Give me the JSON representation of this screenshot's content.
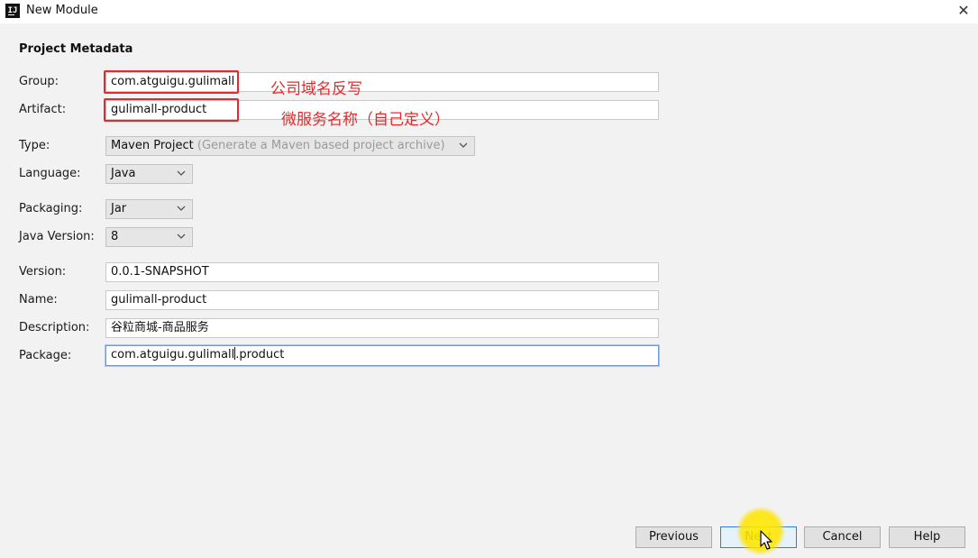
{
  "window": {
    "title": "New Module",
    "app_icon_text": "IJ",
    "close_glyph": "✕"
  },
  "section_title": "Project Metadata",
  "fields": {
    "group": {
      "label": "Group:",
      "value": "com.atguigu.gulimall"
    },
    "artifact": {
      "label": "Artifact:",
      "value": "gulimall-product"
    },
    "type": {
      "label": "Type:",
      "value": "Maven Project",
      "hint": "(Generate a Maven based project archive)"
    },
    "language": {
      "label": "Language:",
      "value": "Java"
    },
    "packaging": {
      "label": "Packaging:",
      "value": "Jar"
    },
    "java_version": {
      "label": "Java Version:",
      "value": "8"
    },
    "version": {
      "label": "Version:",
      "value": "0.0.1-SNAPSHOT"
    },
    "name": {
      "label": "Name:",
      "value": "gulimall-product"
    },
    "description": {
      "label": "Description:",
      "value": "谷粒商城-商品服务"
    },
    "package": {
      "label": "Package:",
      "value_before_caret": "com.atguigu.gulimall",
      "value_after_caret": ".product"
    }
  },
  "annotations": {
    "group_note": "公司域名反写",
    "artifact_note": "微服务名称（自己定义）"
  },
  "buttons": {
    "previous": "Previous",
    "next": "Next",
    "cancel": "Cancel",
    "help": "Help"
  },
  "colors": {
    "annotation_red": "#e32b2b",
    "focus_blue": "#6a9bd6",
    "cursor_highlight": "#ffe600"
  },
  "icons": {
    "close": "close-icon",
    "dropdown": "chevron-down-icon",
    "app": "intellij-logo-icon",
    "pointer": "mouse-pointer-icon"
  }
}
